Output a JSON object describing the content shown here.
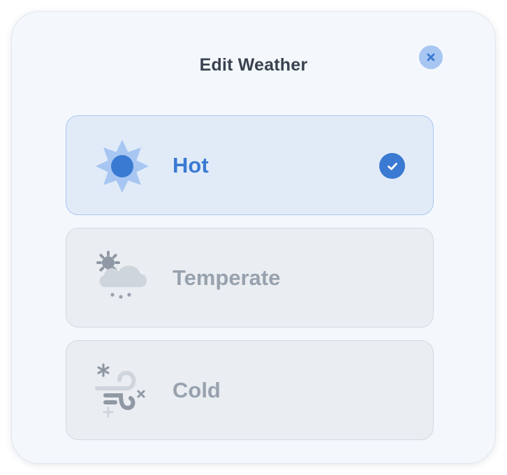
{
  "dialog": {
    "title": "Edit Weather"
  },
  "options": [
    {
      "label": "Hot",
      "icon": "sun-icon",
      "selected": true
    },
    {
      "label": "Temperate",
      "icon": "sun-cloud-icon",
      "selected": false
    },
    {
      "label": "Cold",
      "icon": "wind-snow-icon",
      "selected": false
    }
  ],
  "colors": {
    "accent": "#3a7ad3",
    "accent_light": "#a7c6f2",
    "selected_bg": "#e1ebf8",
    "unselected_bg": "#eaedf1",
    "muted_text": "#98a2ae",
    "title_text": "#3a4250"
  }
}
